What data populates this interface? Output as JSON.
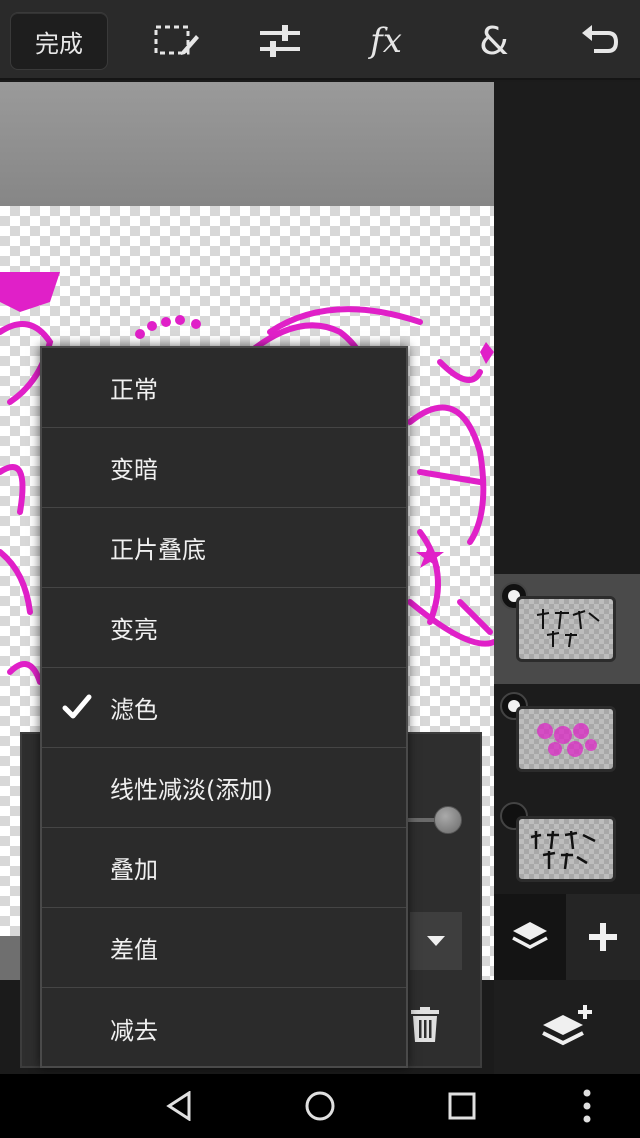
{
  "toolbar": {
    "done_label": "完成",
    "icons": [
      "selection-edit-icon",
      "adjust-sliders-icon",
      "fx-icon",
      "ampersand-icon",
      "undo-icon"
    ],
    "fx_text": "fx",
    "amp_text": "&"
  },
  "blend_menu": {
    "items": [
      {
        "label": "正常",
        "checked": false
      },
      {
        "label": "变暗",
        "checked": false
      },
      {
        "label": "正片叠底",
        "checked": false
      },
      {
        "label": "变亮",
        "checked": false
      },
      {
        "label": "滤色",
        "checked": true
      },
      {
        "label": "线性减淡(添加)",
        "checked": false
      },
      {
        "label": "叠加",
        "checked": false
      },
      {
        "label": "差值",
        "checked": false
      },
      {
        "label": "减去",
        "checked": false
      }
    ]
  },
  "layers": [
    {
      "visible": true,
      "selected": true,
      "thumb": "text-art-thumb"
    },
    {
      "visible": true,
      "selected": false,
      "thumb": "pink-art-thumb"
    },
    {
      "visible": false,
      "selected": false,
      "thumb": "bw-text-thumb"
    }
  ],
  "layer_properties": {
    "opacity_fraction": 1.0
  },
  "navbar": {
    "icons": [
      "back-icon",
      "home-icon",
      "recents-icon",
      "overflow-menu-icon"
    ]
  },
  "colors": {
    "accent_pink": "#e020c8",
    "menu_bg": "#2b2b2b",
    "toolbar_bg": "#2a2a2a"
  }
}
